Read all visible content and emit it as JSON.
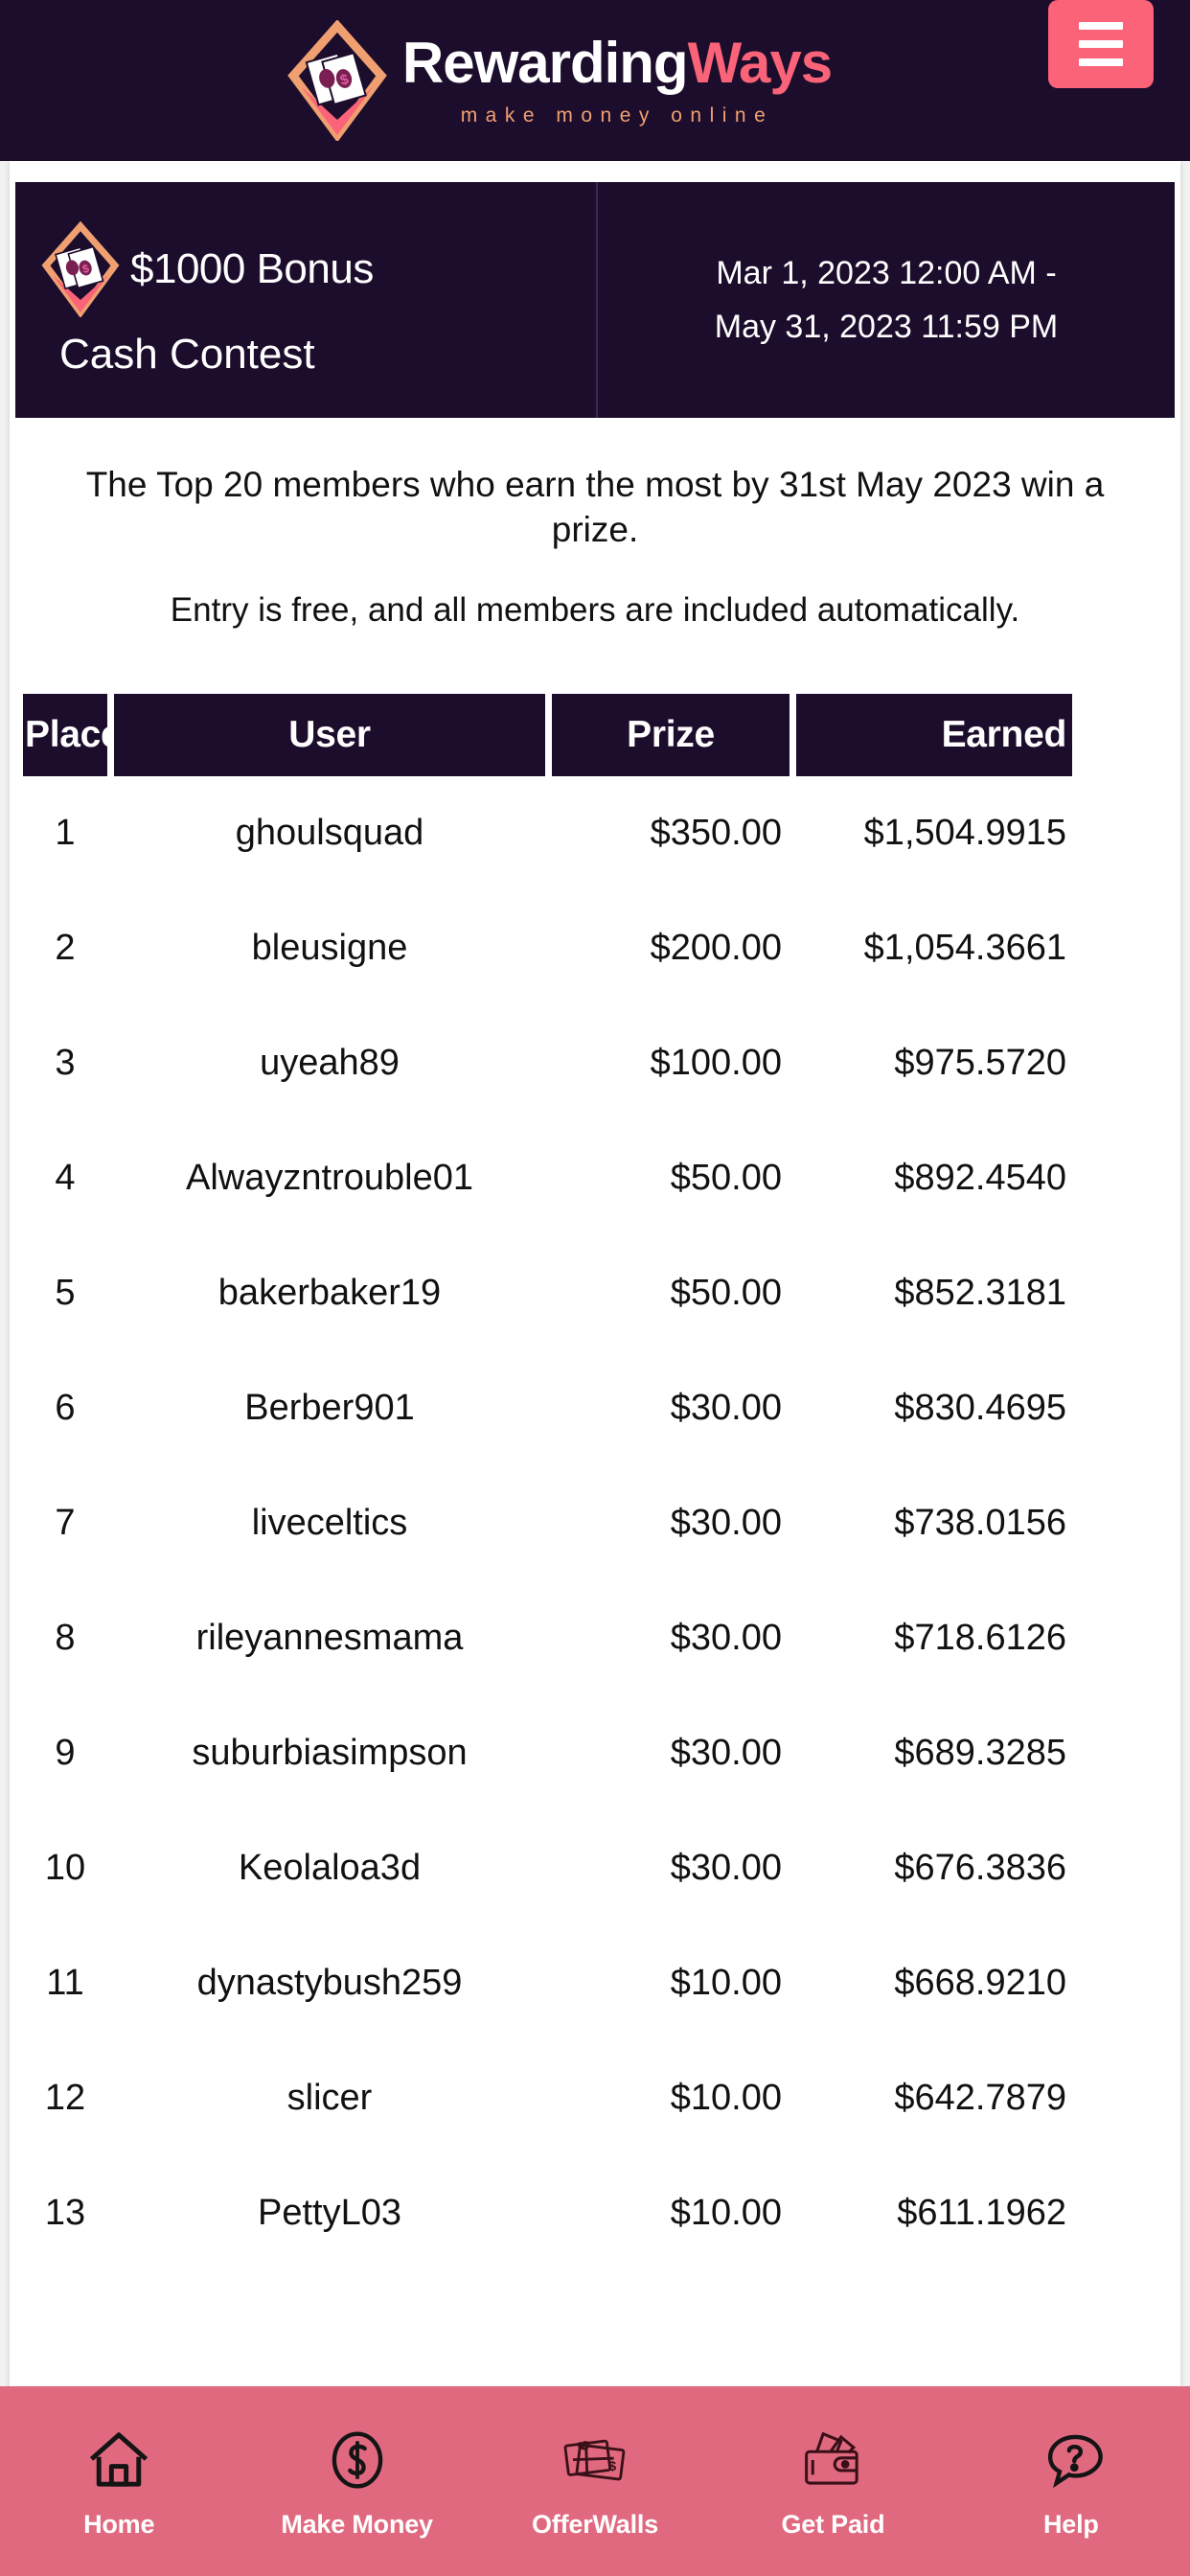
{
  "header": {
    "brand_part1": "Rewarding",
    "brand_part2": "Ways",
    "tagline": "make money online",
    "menu_icon": "hamburger-menu-icon",
    "logo_icon": "diamond-cash-logo-icon",
    "bg_color": "#1d0d2c",
    "accent_color": "#fa6378"
  },
  "banner": {
    "logo_icon": "diamond-cash-logo-icon",
    "title": "$1000 Bonus",
    "subtitle": "Cash Contest",
    "date_range": "Mar 1, 2023 12:00 AM - May 31, 2023 11:59 PM",
    "date_line1": "Mar 1, 2023 12:00 AM -",
    "date_line2": "May 31, 2023 11:59 PM",
    "bg_color": "#1d0d2c"
  },
  "description": {
    "line1": "The Top 20 members who earn the most by 31st May 2023 win a prize.",
    "line2": "Entry is free, and all members are included automatically."
  },
  "leaderboard": {
    "columns": [
      "Place",
      "User",
      "Prize",
      "Earned"
    ],
    "rows": [
      {
        "place": "1",
        "user": "ghoulsquad",
        "prize": "$350.00",
        "earned": "$1,504.9915"
      },
      {
        "place": "2",
        "user": "bleusigne",
        "prize": "$200.00",
        "earned": "$1,054.3661"
      },
      {
        "place": "3",
        "user": "uyeah89",
        "prize": "$100.00",
        "earned": "$975.5720"
      },
      {
        "place": "4",
        "user": "Alwayzntrouble01",
        "prize": "$50.00",
        "earned": "$892.4540"
      },
      {
        "place": "5",
        "user": "bakerbaker19",
        "prize": "$50.00",
        "earned": "$852.3181"
      },
      {
        "place": "6",
        "user": "Berber901",
        "prize": "$30.00",
        "earned": "$830.4695"
      },
      {
        "place": "7",
        "user": "liveceltics",
        "prize": "$30.00",
        "earned": "$738.0156"
      },
      {
        "place": "8",
        "user": "rileyannesmama",
        "prize": "$30.00",
        "earned": "$718.6126"
      },
      {
        "place": "9",
        "user": "suburbiasimpson",
        "prize": "$30.00",
        "earned": "$689.3285"
      },
      {
        "place": "10",
        "user": "Keolaloa3d",
        "prize": "$30.00",
        "earned": "$676.3836"
      },
      {
        "place": "11",
        "user": "dynastybush259",
        "prize": "$10.00",
        "earned": "$668.9210"
      },
      {
        "place": "12",
        "user": "slicer",
        "prize": "$10.00",
        "earned": "$642.7879"
      },
      {
        "place": "13",
        "user": "PettyL03",
        "prize": "$10.00",
        "earned": "$611.1962"
      }
    ]
  },
  "bottom_nav": {
    "bg_color": "#e0697f",
    "items": [
      {
        "label": "Home",
        "icon": "house-icon"
      },
      {
        "label": "Make Money",
        "icon": "dollar-circle-icon"
      },
      {
        "label": "OfferWalls",
        "icon": "gift-cards-icon"
      },
      {
        "label": "Get Paid",
        "icon": "wallet-cash-icon"
      },
      {
        "label": "Help",
        "icon": "question-chat-icon"
      }
    ]
  }
}
